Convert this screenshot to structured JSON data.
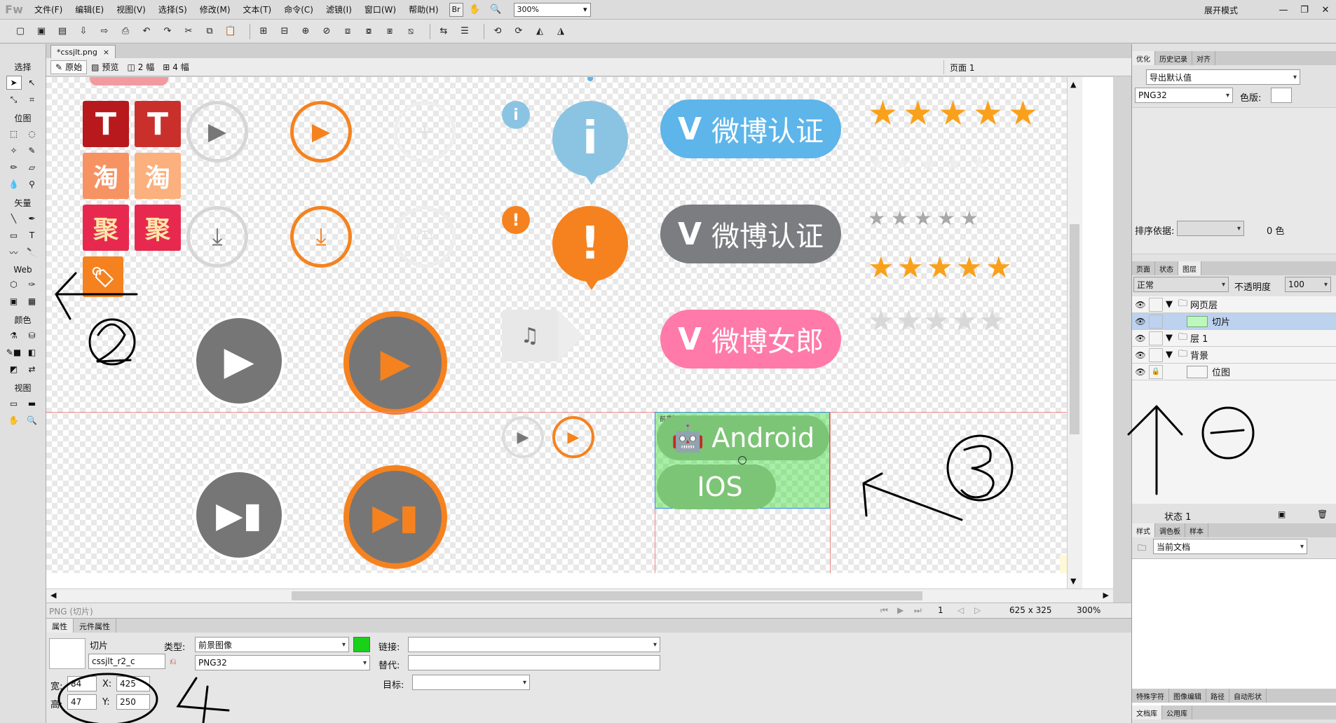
{
  "menubar": {
    "logo": "Fw",
    "items": [
      "文件(F)",
      "编辑(E)",
      "视图(V)",
      "选择(S)",
      "修改(M)",
      "文本(T)",
      "命令(C)",
      "滤镜(I)",
      "窗口(W)",
      "帮助(H)"
    ],
    "zoom": "300%",
    "mode": "展开模式"
  },
  "tools": {
    "sections": [
      "选择",
      "位图",
      "矢量",
      "Web",
      "颜色",
      "视图"
    ]
  },
  "document": {
    "tab": "*cssjlt.png",
    "views": [
      "原始",
      "预览",
      "2 幅",
      "4 幅"
    ],
    "page": "页面 1"
  },
  "canvas": {
    "squares": [
      "T",
      "T",
      "淘",
      "淘",
      "聚",
      "聚"
    ],
    "badge_weibo_1": "微博认证",
    "badge_weibo_2": "微博认证",
    "badge_weibo_3": "微博女郎",
    "btn_android": "Android",
    "btn_ios": "IOS",
    "slice_label": "前景图像: PNG"
  },
  "statusbar": {
    "left": "PNG (切片)",
    "frame": "1",
    "size": "625 x 325",
    "zoom": "300%"
  },
  "properties": {
    "tabs": [
      "属性",
      "元件属性"
    ],
    "slice_name": "切片",
    "slice_id": "cssjlt_r2_c",
    "width_label": "宽:",
    "width": "84",
    "height_label": "高:",
    "height": "47",
    "x_label": "X:",
    "x": "425",
    "y_label": "Y:",
    "y": "250",
    "type_label": "类型:",
    "type": "前景图像",
    "format": "PNG32",
    "link_label": "链接:",
    "alt_label": "替代:",
    "target_label": "目标:"
  },
  "right_panel": {
    "top_tabs": [
      "优化",
      "历史记录",
      "对齐"
    ],
    "export_preset": "导出默认值",
    "format": "PNG32",
    "palette_label": "色版:",
    "sort_label": "排序依据:",
    "colors": "0 色",
    "layer_tabs": [
      "页面",
      "状态",
      "图层"
    ],
    "blend": "正常",
    "opacity_label": "不透明度",
    "opacity": "100",
    "layers": [
      {
        "name": "网页层",
        "indent": 0
      },
      {
        "name": "切片",
        "indent": 1
      },
      {
        "name": "层 1",
        "indent": 0
      },
      {
        "name": "背景",
        "indent": 0
      },
      {
        "name": "位图",
        "indent": 1
      }
    ],
    "state": "状态 1",
    "style_tabs": [
      "样式",
      "调色板",
      "样本"
    ],
    "style_source": "当前文档",
    "bottom_tabs1": [
      "特殊字符",
      "图像编辑",
      "路径",
      "自动形状"
    ],
    "bottom_tabs2": [
      "文档库",
      "公用库"
    ]
  },
  "colors": {
    "orange": "#f5821f",
    "weibo_blue": "#5db5ea",
    "weibo_gray": "#7b7d80",
    "weibo_pink": "#ff7aa8",
    "android_green": "#7cc576",
    "selection_blue": "#bcd2ee"
  }
}
